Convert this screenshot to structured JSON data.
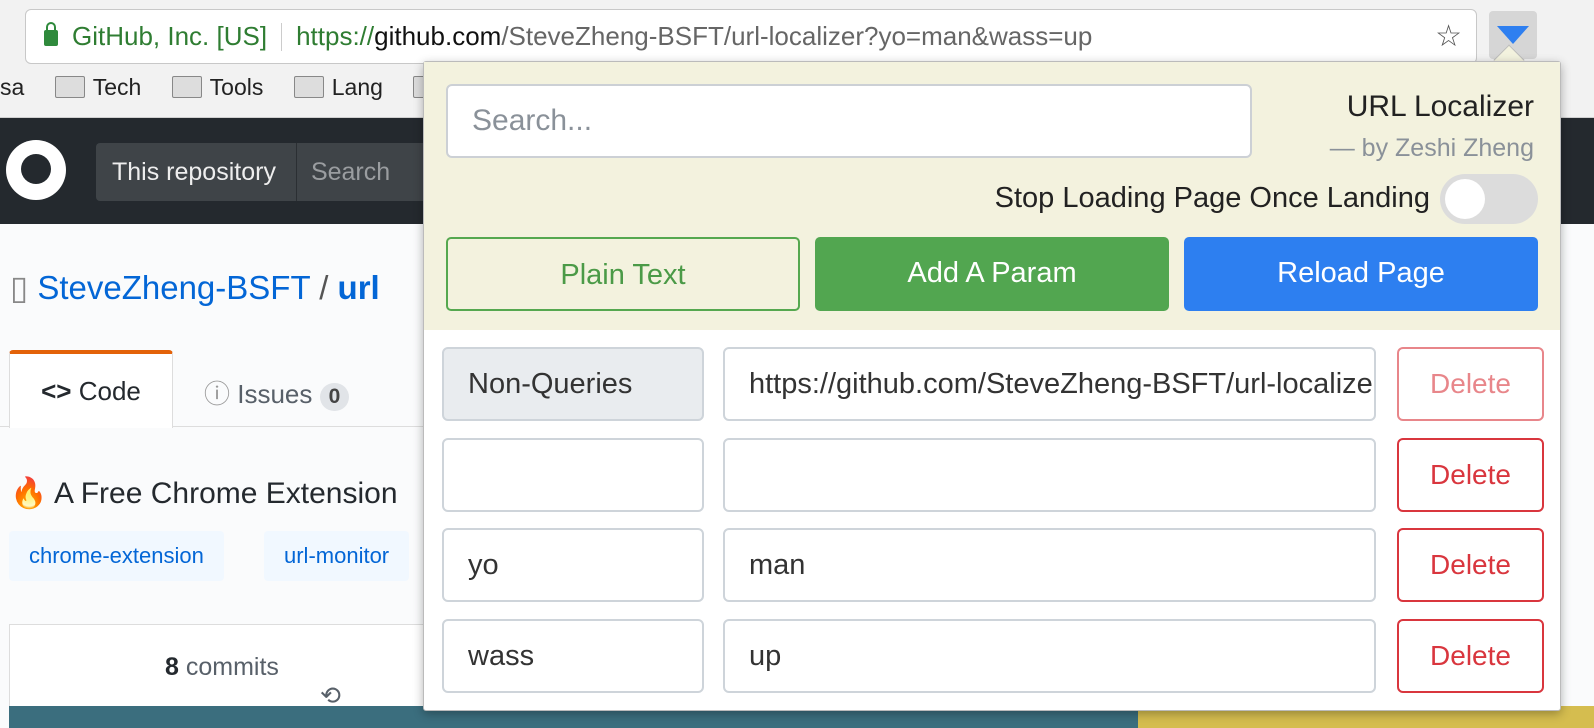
{
  "browser": {
    "site_identity": "GitHub, Inc. [US]",
    "url_scheme": "https://",
    "url_host": "github.com",
    "url_path": "/SteveZheng-BSFT/url-localizer?yo=man&wass=up",
    "bookmarks": [
      "sa",
      "Tech",
      "Tools",
      "Lang",
      ""
    ]
  },
  "github": {
    "search_scope": "This repository",
    "search_placeholder": "Search",
    "owner": "SteveZheng-BSFT",
    "slash": "/",
    "repo": "url",
    "tabs": [
      {
        "label": "Code"
      },
      {
        "label": "Issues",
        "count": "0"
      }
    ],
    "description": "🔥 A Free Chrome Extension",
    "topics": [
      "chrome-extension",
      "url-monitor"
    ],
    "commits_count": "8",
    "commits_label": "commits"
  },
  "popup": {
    "search_placeholder": "Search...",
    "title": "URL Localizer",
    "author": "— by Zeshi Zheng",
    "stop_label": "Stop Loading Page Once Landing",
    "stop_enabled": false,
    "buttons": {
      "plain": "Plain Text",
      "add": "Add A Param",
      "reload": "Reload Page"
    },
    "rows": [
      {
        "key": "Non-Queries",
        "value": "https://github.com/SteveZheng-BSFT/url-localizer",
        "delete": "Delete"
      },
      {
        "key": "",
        "value": "",
        "delete": "Delete"
      },
      {
        "key": "yo",
        "value": "man",
        "delete": "Delete"
      },
      {
        "key": "wass",
        "value": "up",
        "delete": "Delete"
      }
    ],
    "colors": {
      "background": "#f3f2de",
      "green": "#52a650",
      "blue": "#2d7ff0",
      "danger": "#d9363e"
    }
  }
}
